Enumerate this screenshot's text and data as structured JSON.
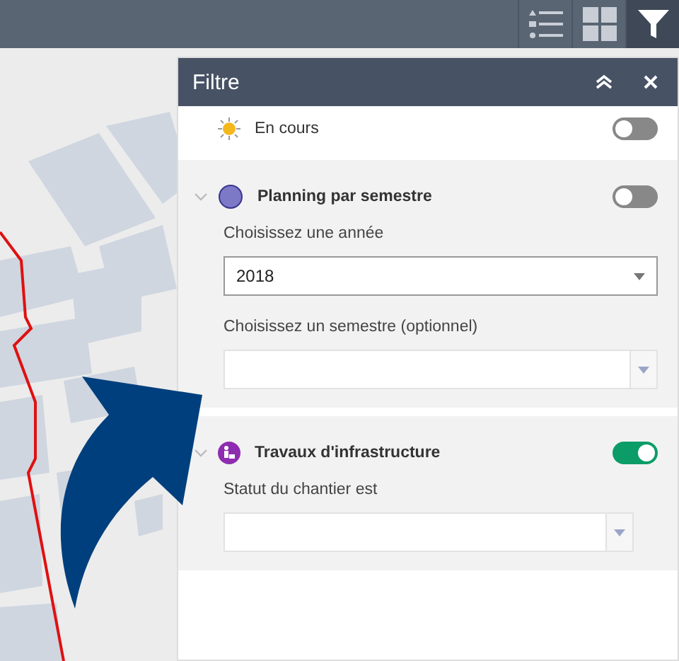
{
  "toolbar": {
    "buttons": [
      {
        "selected": false
      },
      {
        "selected": false
      },
      {
        "selected": true
      }
    ]
  },
  "panel": {
    "title": "Filtre",
    "filters": [
      {
        "kind": "plain",
        "label": "En cours",
        "on": false
      },
      {
        "kind": "group",
        "label": "Planning par semestre",
        "on": false,
        "expanded": true,
        "fields": [
          {
            "label": "Choisissez une année",
            "value": "2018"
          },
          {
            "label": "Choisissez un semestre (optionnel)"
          }
        ]
      },
      {
        "kind": "group",
        "label": "Travaux d'infrastructure",
        "on": true,
        "expanded": true,
        "fields": [
          {
            "label": "Statut du chantier est"
          }
        ]
      }
    ]
  }
}
